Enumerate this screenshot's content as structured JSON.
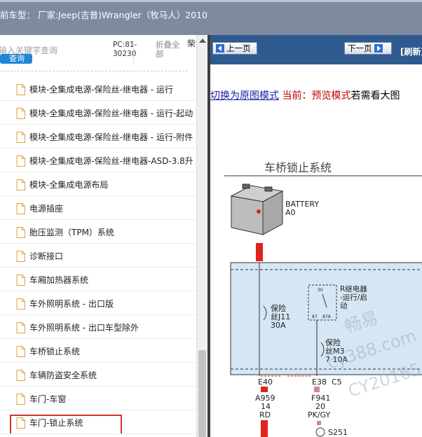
{
  "header": {
    "title": "前车型： 厂家:Jeep(吉普)Wrangler（牧马人）2010"
  },
  "search": {
    "placeholder": "输入关键字查询",
    "button": "查询",
    "pc_label": "PC:81-30230",
    "fold_all": "折叠全部",
    "extra": "柴"
  },
  "tree": {
    "items": [
      "模块-全集成电源-保险丝-继电器 - 运行",
      "模块-全集成电源-保险丝-继电器 - 运行-起动",
      "模块-全集成电源-保险丝-继电器 - 运行-附件",
      "模块-全集成电源-保险丝-继电器-ASD-3.8升",
      "模块-全集成电源布局",
      "电源插座",
      "胎压监测（TPM）系统",
      "诊断接口",
      "车厢加热器系统",
      "车外照明系统 - 出口版",
      "车外照明系统 - 出口车型除外",
      "车桥锁止系统",
      "车辆防盗安全系统",
      "车门-车窗",
      "车门-锁止系统"
    ],
    "selected": "车门-锁止系统"
  },
  "viewer": {
    "prev": "上一页",
    "next": "下一页",
    "refresh": "[刷新]",
    "switch_link": "切换为原图模式",
    "current": "当前：预览模式",
    "hint": "若需看大图"
  },
  "diagram": {
    "title": "车桥锁止系统",
    "battery": "BATTERY",
    "battery_id": "A0",
    "fuse1_a": "保险",
    "fuse1_b": "丝J11",
    "fuse1_c": "30A",
    "relay_a": "R继电器",
    "relay_b": "-运行/启",
    "relay_c": "动",
    "relay_p30": "30",
    "relay_p87": "87",
    "relay_p87a": "87A",
    "fuse2_a": "保险",
    "fuse2_b": "丝M3",
    "fuse2_c": "7 10A",
    "conn1": "E40",
    "conn2": "E38",
    "conn3": "C5",
    "wire1_a": "A959",
    "wire1_b": "14",
    "wire1_c": "RD",
    "wire2_a": "F941",
    "wire2_b": "20",
    "wire2_c": "PK/GY",
    "splice": "S251",
    "watermark1": "畅易",
    "watermark2": "cy388.com",
    "watermark3": "CY20165"
  },
  "colors": {
    "nav_blue": "#2f5a8f",
    "module_fill": "#d5e6f4",
    "wire_red": "#e0231c",
    "selected_border": "#d9342b"
  }
}
